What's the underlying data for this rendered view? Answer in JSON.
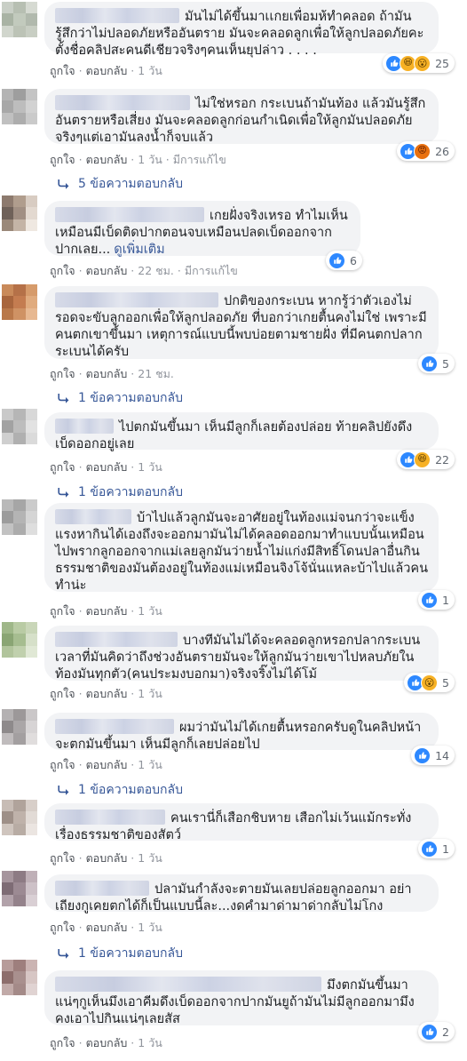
{
  "comments": [
    {
      "text": "มันไม่ได้ขึ้นมาเเกยเพื่อมห้ทำคลอด ถ้ามันรู้สึกว่าไม่ปลอดภัยหรืออันตราย มันจะคลอดลูกเพื่อให้ลูกปลอดภัยคะ ตั้งชื่อคลิปสะคนดีเชียวจริงๆคนเห็นยุปล่าว . . . .",
      "actions": {
        "like": "ถูกใจ",
        "reply": "ตอบกลับ",
        "time": "1 วัน",
        "edited": ""
      },
      "reaction_count": "25",
      "reaction_icons": [
        "like-icon",
        "haha-icon",
        "wow-icon"
      ],
      "replies_label": ""
    },
    {
      "text": "ไม่ใช่หรอก กระเบนถ้ามันท้อง แล้วมันรู้สึกอันตรายหรือเสี่ยง มันจะคลอดลูกก่อนกำเนิดเพื่อให้ลูกมันปลอดภัย จริงๆแต่เอามันลงน้ำก็จบแล้ว",
      "actions": {
        "like": "ถูกใจ",
        "reply": "ตอบกลับ",
        "time": "1 วัน",
        "edited": "มีการแก้ไข"
      },
      "reaction_count": "26",
      "reaction_icons": [
        "like-icon",
        "angry-icon"
      ],
      "replies_label": "5 ข้อความตอบกลับ"
    },
    {
      "text": "เกยฝั่งจริงเหรอ ทำไมเห็นเหมือนมีเบ็ดติดปากตอนจบเหมือนปลดเบ็ดออกจากปากเลย...",
      "see_more": "ดูเพิ่มเติม",
      "actions": {
        "like": "ถูกใจ",
        "reply": "ตอบกลับ",
        "time": "22 ชม.",
        "edited": "มีการแก้ไข"
      },
      "reaction_count": "6",
      "reaction_icons": [
        "like-icon"
      ],
      "replies_label": ""
    },
    {
      "text": "ปกติของกระเบน หากรู้ว่าตัวเองไม่รอดจะขับลูกออกเพื่อให้ลูกปลอดภัย ที่บอกว่าเกยตื้นคงไม่ใช่ เพราะมีคนตกเขาขึ้นมา เหตุการณ์แบบนี้พบบ่อยตามชายฝั่ง ที่มีคนตกปลากระเบนได้ครับ",
      "actions": {
        "like": "ถูกใจ",
        "reply": "ตอบกลับ",
        "time": "21 ชม.",
        "edited": ""
      },
      "reaction_count": "5",
      "reaction_icons": [
        "like-icon"
      ],
      "replies_label": "1 ข้อความตอบกลับ"
    },
    {
      "text": "ไปตกมันขึ้นมา เห็นมีลูกก็เลยต้องปล่อย ท้ายคลิปยังดึงเบ็ดออกอยู่เลย",
      "actions": {
        "like": "ถูกใจ",
        "reply": "ตอบกลับ",
        "time": "1 วัน",
        "edited": ""
      },
      "reaction_count": "22",
      "reaction_icons": [
        "like-icon",
        "haha-icon"
      ],
      "replies_label": "1 ข้อความตอบกลับ"
    },
    {
      "text": "บ้าไปแล้วลูกมันจะอาศัยอยู่ในท้องแม่จนกว่าจะแข็งแรงหากินได้เองถึงจะออกมามันไม่ได้คลอดออกมาทำแบบนั้นเหมือนไปพรากลูกออกจากแม่เลยลูกมันว่ายน้ำไม่แก่งมีสิทธิ์โดนปลาอื่นกินธรรมชาติของมันต้องอยู่ในท้องแม่เหมือนจิงโจ้นั่นแหละบ้าไปแล้วคนทำน่ะ",
      "actions": {
        "like": "ถูกใจ",
        "reply": "ตอบกลับ",
        "time": "1 วัน",
        "edited": ""
      },
      "reaction_count": "1",
      "reaction_icons": [
        "like-icon"
      ],
      "replies_label": ""
    },
    {
      "text": "บางทีมันไม่ได้จะคลอดลูกหรอกปลากระเบนเวลาที่มันคิดว่าถึงช่วงอันตรายมันจะให้ลูกมันว่ายเขาไปหลบภัยในท้องมันทุกตัว(คนประมงบอกมา)จริงจริ๊งไม่ได้โม้",
      "actions": {
        "like": "ถูกใจ",
        "reply": "ตอบกลับ",
        "time": "1 วัน",
        "edited": ""
      },
      "reaction_count": "5",
      "reaction_icons": [
        "like-icon",
        "wow-icon"
      ],
      "replies_label": ""
    },
    {
      "text": "ผมว่ามันไม่ได้เกยตื้นหรอกครับดูในคลิปหน้าจะตกมันขึ้นมา เห็นมีลูกก็เลยปล่อยไป",
      "actions": {
        "like": "ถูกใจ",
        "reply": "ตอบกลับ",
        "time": "1 วัน",
        "edited": ""
      },
      "reaction_count": "14",
      "reaction_icons": [
        "like-icon"
      ],
      "replies_label": "1 ข้อความตอบกลับ"
    },
    {
      "text": "คนเรานี่ก็เสือกชิบหาย เสือกไม่เว้นแม้กระทั่งเรื่องธรรมชาติของสัตว์",
      "actions": {
        "like": "ถูกใจ",
        "reply": "ตอบกลับ",
        "time": "1 วัน",
        "edited": ""
      },
      "reaction_count": "1",
      "reaction_icons": [
        "like-icon"
      ],
      "replies_label": ""
    },
    {
      "text": "ปลามันกำลังจะตายมันเลยปล่อยลูกออกมา อย่าเถียงกูเคยตกได้ก็เป็นแบบนี้ละ...งดคำมาด่ามาด่ากลับไม่โกง",
      "actions": {
        "like": "ถูกใจ",
        "reply": "ตอบกลับ",
        "time": "1 วัน",
        "edited": ""
      },
      "reaction_count": "",
      "reaction_icons": [],
      "replies_label": "1 ข้อความตอบกลับ"
    },
    {
      "text": "มึงตกมันขึ้นมาแน่ๆกูเห็นมึงเอาคีมดึงเบ็ดออกจากปากมันยูถ้ามันไม่มีลูกออกมามึงคงเอาไปกินแน่ๆเลยสัส",
      "actions": {
        "like": "ถูกใจ",
        "reply": "ตอบกลับ",
        "time": "1 วัน",
        "edited": ""
      },
      "reaction_count": "2",
      "reaction_icons": [
        "like-icon"
      ],
      "replies_label": ""
    }
  ],
  "colors": {
    "bubble": "#f2f3f5",
    "link": "#385898",
    "meta": "#90949c",
    "like": "#2d88ff"
  }
}
